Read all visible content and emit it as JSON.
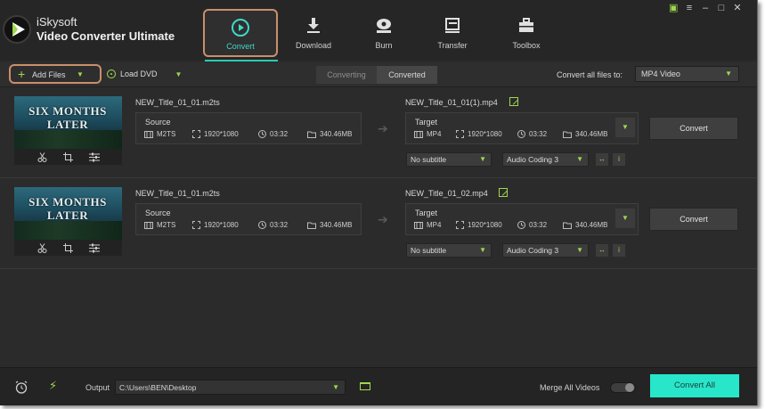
{
  "app": {
    "brand_line1": "iSkysoft",
    "brand_line2": "Video Converter Ultimate"
  },
  "nav": [
    {
      "label": "Convert",
      "icon": "convert-icon",
      "active": true
    },
    {
      "label": "Download",
      "icon": "download-icon",
      "active": false
    },
    {
      "label": "Burn",
      "icon": "burn-icon",
      "active": false
    },
    {
      "label": "Transfer",
      "icon": "transfer-icon",
      "active": false
    },
    {
      "label": "Toolbox",
      "icon": "toolbox-icon",
      "active": false
    }
  ],
  "toolbar": {
    "add_files": "Add Files",
    "load_dvd": "Load DVD",
    "tab_converting": "Converting",
    "tab_converted": "Converted",
    "convert_all_label": "Convert all files to:",
    "format": "MP4 Video"
  },
  "files": [
    {
      "thumb_title": "SIX MONTHS LATER",
      "source_name": "NEW_Title_01_01.m2ts",
      "source_label": "Source",
      "source_format": "M2TS",
      "source_res": "1920*1080",
      "source_duration": "03:32",
      "source_size": "340.46MB",
      "target_name": "NEW_Title_01_01(1).mp4",
      "target_label": "Target",
      "target_format": "MP4",
      "target_res": "1920*1080",
      "target_duration": "03:32",
      "target_size": "340.46MB",
      "convert": "Convert",
      "subtitle": "No subtitle",
      "audio": "Audio Coding 3"
    },
    {
      "thumb_title": "SIX MONTHS LATER",
      "source_name": "NEW_Title_01_01.m2ts",
      "source_label": "Source",
      "source_format": "M2TS",
      "source_res": "1920*1080",
      "source_duration": "03:32",
      "source_size": "340.46MB",
      "target_name": "NEW_Title_01_02.mp4",
      "target_label": "Target",
      "target_format": "MP4",
      "target_res": "1920*1080",
      "target_duration": "03:32",
      "target_size": "340.46MB",
      "convert": "Convert",
      "subtitle": "No subtitle",
      "audio": "Audio Coding 3"
    }
  ],
  "footer": {
    "output_label": "Output",
    "output_path": "C:\\Users\\BEN\\Desktop",
    "merge_label": "Merge All Videos",
    "convert_all": "Convert All"
  },
  "colors": {
    "accent": "#28cdb7",
    "highlight": "#c98f6b",
    "icon_green": "#9fd84f",
    "convert_all_bg": "#27e6ca"
  }
}
